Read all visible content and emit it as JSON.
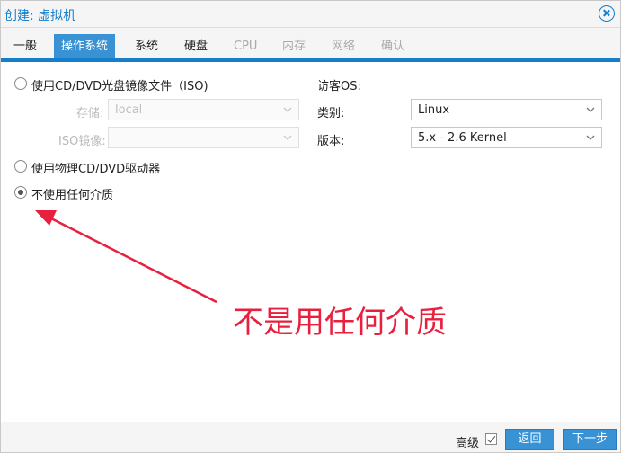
{
  "window": {
    "title": "创建: 虚拟机"
  },
  "tabs": [
    {
      "label": "一般",
      "state": "normal"
    },
    {
      "label": "操作系统",
      "state": "active"
    },
    {
      "label": "系统",
      "state": "normal"
    },
    {
      "label": "硬盘",
      "state": "normal"
    },
    {
      "label": "CPU",
      "state": "disabled"
    },
    {
      "label": "内存",
      "state": "disabled"
    },
    {
      "label": "网络",
      "state": "disabled"
    },
    {
      "label": "确认",
      "state": "disabled"
    }
  ],
  "media": {
    "iso_option": {
      "label": "使用CD/DVD光盘镜像文件（ISO)",
      "checked": false
    },
    "storage": {
      "label": "存储:",
      "value": "local",
      "disabled": true
    },
    "iso_image": {
      "label": "ISO镜像:",
      "value": "",
      "disabled": true
    },
    "physical_option": {
      "label": "使用物理CD/DVD驱动器",
      "checked": false
    },
    "none_option": {
      "label": "不使用任何介质",
      "checked": true
    }
  },
  "guest_os": {
    "heading": "访客OS:",
    "type": {
      "label": "类别:",
      "value": "Linux"
    },
    "version": {
      "label": "版本:",
      "value": "5.x - 2.6 Kernel"
    }
  },
  "annotation": {
    "text": "不是用任何介质",
    "color": "#e8203e"
  },
  "footer": {
    "advanced_label": "高级",
    "advanced_checked": true,
    "back_label": "返回",
    "next_label": "下一步"
  },
  "colors": {
    "accent": "#157fcc",
    "button": "#3892d4",
    "annotation": "#e8203e"
  }
}
